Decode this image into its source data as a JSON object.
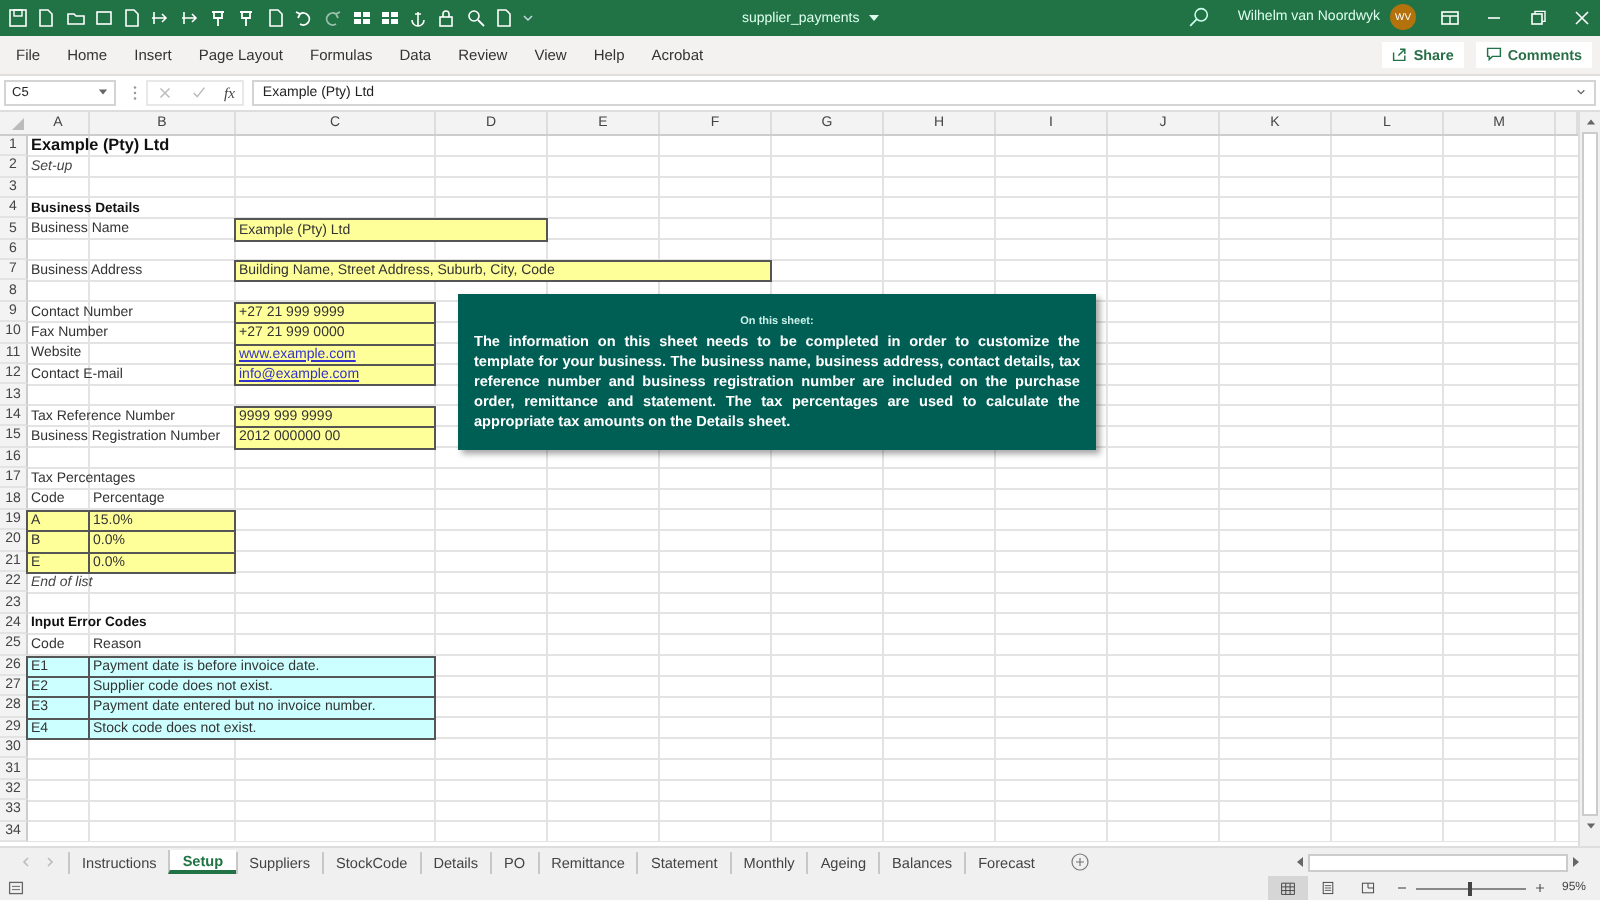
{
  "title_bar": {
    "file_name": "supplier_payments",
    "user": "Wilhelm van Noordwyk",
    "initials": "WV"
  },
  "menu": [
    "File",
    "Home",
    "Insert",
    "Page Layout",
    "Formulas",
    "Data",
    "Review",
    "View",
    "Help",
    "Acrobat"
  ],
  "share": "Share",
  "comments": "Comments",
  "formula_bar": {
    "name_box": "C5",
    "fx": "fx",
    "formula": "Example (Pty) Ltd"
  },
  "columns": [
    "A",
    "B",
    "C",
    "D",
    "E",
    "F",
    "G",
    "H",
    "I",
    "J",
    "K",
    "L",
    "M"
  ],
  "rows": [
    {
      "number": "1",
      "cells": [
        {
          "kind": "title",
          "text": "Example (Pty) Ltd"
        }
      ]
    },
    {
      "number": "2",
      "cells": [
        {
          "kind": "note",
          "text": "Set-up"
        }
      ]
    },
    {
      "number": "3",
      "cells": []
    },
    {
      "number": "4",
      "cells": [
        {
          "kind": "heading",
          "text": "Business Details"
        }
      ]
    },
    {
      "number": "5",
      "cells": [
        {
          "kind": "label",
          "text": "Business Name"
        },
        {
          "kind": "value_wide",
          "text": "Example (Pty) Ltd"
        }
      ]
    },
    {
      "number": "6",
      "cells": []
    },
    {
      "number": "7",
      "cells": [
        {
          "kind": "label",
          "text": "Business Address"
        },
        {
          "kind": "value_full",
          "text": "Building Name, Street Address, Suburb, City, Code"
        }
      ]
    },
    {
      "number": "8",
      "cells": []
    },
    {
      "number": "9",
      "cells": [
        {
          "kind": "label",
          "text": "Contact Number"
        },
        {
          "kind": "value",
          "text": "+27 21 999 9999"
        }
      ]
    },
    {
      "number": "10",
      "cells": [
        {
          "kind": "label",
          "text": "Fax Number"
        },
        {
          "kind": "value",
          "text": "+27 21 999 0000"
        }
      ]
    },
    {
      "number": "11",
      "cells": [
        {
          "kind": "label",
          "text": "Website"
        },
        {
          "kind": "link",
          "text": "www.example.com"
        }
      ]
    },
    {
      "number": "12",
      "cells": [
        {
          "kind": "label",
          "text": "Contact E-mail"
        },
        {
          "kind": "link",
          "text": "info@example.com"
        }
      ]
    },
    {
      "number": "13",
      "cells": []
    },
    {
      "number": "14",
      "cells": [
        {
          "kind": "label",
          "text": "Tax Reference Number"
        },
        {
          "kind": "value",
          "text": "9999 999 9999"
        }
      ]
    },
    {
      "number": "15",
      "cells": [
        {
          "kind": "label",
          "text": "Business Registration Number"
        },
        {
          "kind": "value",
          "text": "2012 000000 00"
        }
      ]
    },
    {
      "number": "16",
      "cells": []
    },
    {
      "number": "17",
      "cells": [
        {
          "kind": "label",
          "text": "Tax Percentages"
        }
      ]
    },
    {
      "number": "18",
      "cells": [
        {
          "kind": "label_a",
          "text": "Code"
        },
        {
          "kind": "label_b",
          "text": "Percentage"
        }
      ]
    },
    {
      "number": "19",
      "cells": [
        {
          "kind": "code",
          "text": "A"
        },
        {
          "kind": "pct",
          "text": "15.0%"
        }
      ]
    },
    {
      "number": "20",
      "cells": [
        {
          "kind": "code",
          "text": "B"
        },
        {
          "kind": "pct",
          "text": "0.0%"
        }
      ]
    },
    {
      "number": "21",
      "cells": [
        {
          "kind": "code",
          "text": "E"
        },
        {
          "kind": "pct",
          "text": "0.0%"
        }
      ]
    },
    {
      "number": "22",
      "cells": [
        {
          "kind": "note",
          "text": "End of list"
        }
      ]
    },
    {
      "number": "23",
      "cells": []
    },
    {
      "number": "24",
      "cells": [
        {
          "kind": "heading",
          "text": "Input Error Codes"
        }
      ]
    },
    {
      "number": "25",
      "cells": [
        {
          "kind": "label_a",
          "text": "Code"
        },
        {
          "kind": "label_b",
          "text": "Reason"
        }
      ]
    },
    {
      "number": "26",
      "cells": [
        {
          "kind": "err_code",
          "text": "E1"
        },
        {
          "kind": "err_reason",
          "text": "Payment date is before invoice date."
        }
      ]
    },
    {
      "number": "27",
      "cells": [
        {
          "kind": "err_code",
          "text": "E2"
        },
        {
          "kind": "err_reason",
          "text": "Supplier code does not exist."
        }
      ]
    },
    {
      "number": "28",
      "cells": [
        {
          "kind": "err_code",
          "text": "E3"
        },
        {
          "kind": "err_reason",
          "text": "Payment date entered but no invoice number."
        }
      ]
    },
    {
      "number": "29",
      "cells": [
        {
          "kind": "err_code",
          "text": "E4"
        },
        {
          "kind": "err_reason",
          "text": "Stock code does not exist."
        }
      ]
    },
    {
      "number": "30",
      "cells": []
    },
    {
      "number": "31",
      "cells": []
    },
    {
      "number": "32",
      "cells": []
    },
    {
      "number": "33",
      "cells": []
    },
    {
      "number": "34",
      "cells": []
    }
  ],
  "note": {
    "title": "On this sheet:",
    "text": "The information on this sheet needs to be completed in order to customize the template for your business. The business name, business address, contact details, tax reference number and business registration number are included on the purchase order, remittance and statement. The tax percentages are used to calculate the appropriate tax amounts on the Details sheet."
  },
  "sheet_tabs": [
    {
      "label": "Instructions",
      "selected": false
    },
    {
      "label": "Setup",
      "selected": true
    },
    {
      "label": "Suppliers",
      "selected": false
    },
    {
      "label": "StockCode",
      "selected": false
    },
    {
      "label": "Details",
      "selected": false
    },
    {
      "label": "PO",
      "selected": false
    },
    {
      "label": "Remittance",
      "selected": false
    },
    {
      "label": "Statement",
      "selected": false
    },
    {
      "label": "Monthly",
      "selected": false
    },
    {
      "label": "Ageing",
      "selected": false
    },
    {
      "label": "Balances",
      "selected": false
    },
    {
      "label": "Forecast",
      "selected": false
    }
  ],
  "views": [
    {
      "kind": "normal",
      "selected": true
    },
    {
      "kind": "page_layout",
      "selected": false
    },
    {
      "kind": "page_break",
      "selected": false
    }
  ],
  "zoom": {
    "level": 0.5,
    "reading": "95%"
  }
}
